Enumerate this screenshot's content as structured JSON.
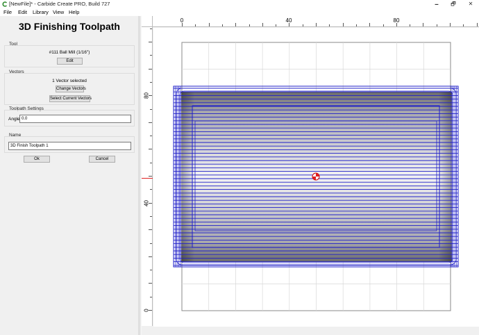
{
  "window": {
    "title": "[NewFile]* - Carbide Create PRO, Build 727",
    "minimize": "🗕",
    "maximize": "🗗",
    "close": "✕"
  },
  "menu": {
    "items": [
      "File",
      "Edit",
      "Library",
      "View",
      "Help"
    ]
  },
  "panel": {
    "title": "3D Finishing Toolpath",
    "tool": {
      "group_label": "Tool",
      "name": "#111 Ball Mill (1/16\")",
      "edit_label": "Edit"
    },
    "vectors": {
      "group_label": "Vectors",
      "status": "1 Vector selected",
      "change_label": "Change Vectors",
      "select_label": "Select Current Vectors"
    },
    "settings": {
      "group_label": "Toolpath Settings",
      "angle_label": "Angle",
      "angle_value": "0.0"
    },
    "name": {
      "group_label": "Name",
      "value": "3D Finish Toolpath 1"
    },
    "ok_label": "Ok",
    "cancel_label": "Cancel"
  },
  "ruler": {
    "top_labels": [
      "0",
      "40",
      "80"
    ],
    "left_labels": [
      "80",
      "40",
      "0"
    ]
  },
  "colors": {
    "toolpath": "#2020c8",
    "origin_marker": "#e02020",
    "stock_fill": "#ffffff",
    "grid": "#d8d8d8"
  },
  "icons": {
    "app": "carbide-logo-icon",
    "origin": "origin-target-icon"
  }
}
